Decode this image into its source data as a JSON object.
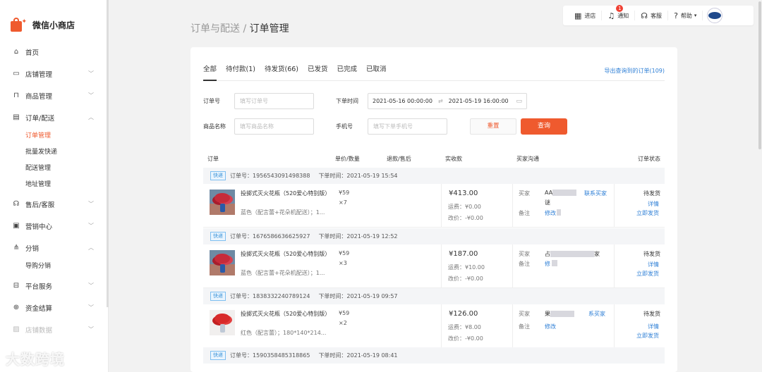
{
  "brand": {
    "name": "微信小商店"
  },
  "nav": [
    {
      "label": "首页",
      "icon": "home-icon",
      "chev": ""
    },
    {
      "label": "店铺管理",
      "icon": "store-icon",
      "chev": "⌵"
    },
    {
      "label": "商品管理",
      "icon": "bag-icon",
      "chev": "⌵"
    },
    {
      "label": "订单/配送",
      "icon": "order-icon",
      "chev": "⌃"
    }
  ],
  "order_sub": [
    "订单管理",
    "批量发快递",
    "配送管理",
    "地址管理"
  ],
  "nav2": [
    {
      "label": "售后/客服",
      "icon": "headset-icon"
    },
    {
      "label": "营销中心",
      "icon": "marketing-icon"
    },
    {
      "label": "分销",
      "icon": "share-icon"
    }
  ],
  "dist_sub": [
    "导购分销"
  ],
  "nav3": [
    {
      "label": "平台服务",
      "icon": "briefcase-icon"
    },
    {
      "label": "资金结算",
      "icon": "coin-icon"
    },
    {
      "label": "店铺数据",
      "icon": "chart-icon"
    }
  ],
  "topbar": {
    "store": "进店",
    "notify": "通知",
    "notify_count": "1",
    "service": "客服",
    "help": "帮助"
  },
  "page": {
    "breadcrumb": "订单与配送 / ",
    "title": "订单管理"
  },
  "tabs": [
    "全部",
    "待付款(1)",
    "待发货(66)",
    "已发货",
    "已完成",
    "已取消"
  ],
  "export_link": "导出查询到的订单(109)",
  "filters": {
    "order_no_label": "订单号",
    "order_no_placeholder": "填写订单号",
    "time_label": "下单时间",
    "time_start": "2021-05-16 00:00:00",
    "time_end": "2021-05-19 16:00:00",
    "product_label": "商品名称",
    "product_placeholder": "填写商品名称",
    "phone_label": "手机号",
    "phone_placeholder": "填写下单手机号",
    "reset": "重置",
    "search": "查询"
  },
  "columns": {
    "order": "订单",
    "price_qty": "单价/数量",
    "refund": "退款/售后",
    "paid": "实收款",
    "buyer": "买家沟通",
    "status": "订单状态"
  },
  "orders": [
    {
      "tag": "快递",
      "no": "订单号：1956543091498388",
      "time": "下单时间：2021-05-19 15:54",
      "title": "投掷式灭火花瓶（520爱心特别版）",
      "spec": "蓝色（配言蕾+花朵机配送）；1...",
      "price": "¥59",
      "qty": "×7",
      "amount": "¥413.00",
      "ship": "运费：¥0.00",
      "adj": "改价：-¥0.00",
      "buyer_label": "买家",
      "buyer_prefix": "AA",
      "buyer_suffix": "谜",
      "contact": "联系买家",
      "note_label": "备注",
      "note": "修改",
      "status": "待发货",
      "detail": "详情",
      "ship_now": "立即发货"
    },
    {
      "tag": "快递",
      "no": "订单号：1676586636625927",
      "time": "下单时间：2021-05-19 12:52",
      "title": "投掷式灭火花瓶（520爱心特别版）",
      "spec": "蓝色（配言蕾+花朵机配送）；1...",
      "price": "¥59",
      "qty": "×3",
      "amount": "¥187.00",
      "ship": "运费：¥10.00",
      "adj": "改价：-¥0.00",
      "buyer_label": "买家",
      "buyer_prefix": "占",
      "buyer_suffix": "家",
      "contact": "",
      "note_label": "备注",
      "note": "修",
      "status": "待发货",
      "detail": "详情",
      "ship_now": "立即发货"
    },
    {
      "tag": "快递",
      "no": "订单号：1838332240789124",
      "time": "下单时间：2021-05-19 09:57",
      "title": "投掷式灭火花瓶（520爱心特别版）",
      "spec": "红色（配言蕾）；180*140*214...",
      "price": "¥59",
      "qty": "×2",
      "amount": "¥126.00",
      "ship": "运费：¥8.00",
      "adj": "改价：-¥0.00",
      "buyer_label": "买家",
      "buyer_prefix": "果",
      "buyer_suffix": "",
      "contact": "系买家",
      "note_label": "备注",
      "note": "修改",
      "status": "待发货",
      "detail": "详情",
      "ship_now": "立即发货"
    },
    {
      "tag": "快递",
      "no": "订单号：1590358485318865",
      "time": "下单时间：2021-05-19 08:41"
    }
  ],
  "watermark": "大数跨境"
}
